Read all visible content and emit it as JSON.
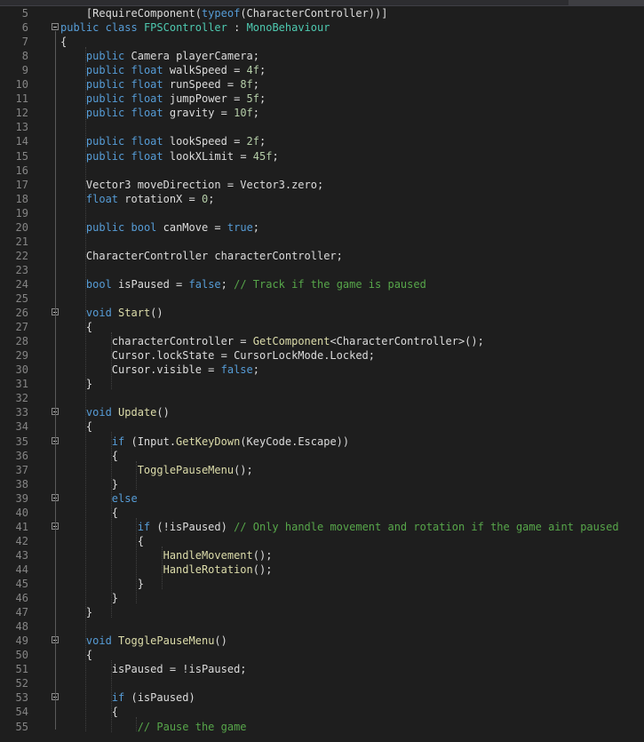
{
  "editor": {
    "lines": [
      {
        "n": "5",
        "t": [
          [
            "    ",
            "id"
          ],
          [
            "[RequireComponent(",
            "id"
          ],
          [
            "typeof",
            "kw"
          ],
          [
            "(CharacterController))]",
            "id"
          ]
        ]
      },
      {
        "n": "6",
        "fold": true,
        "t": [
          [
            "public",
            "kw"
          ],
          [
            " ",
            "id"
          ],
          [
            "class",
            "kw"
          ],
          [
            " ",
            "id"
          ],
          [
            "FPSController",
            "ty"
          ],
          [
            " : ",
            "id"
          ],
          [
            "MonoBehaviour",
            "ty"
          ]
        ]
      },
      {
        "n": "7",
        "t": [
          [
            "{",
            "id"
          ]
        ]
      },
      {
        "n": "8",
        "t": [
          [
            "    ",
            "id"
          ],
          [
            "public",
            "kw"
          ],
          [
            " Camera playerCamera;",
            "id"
          ]
        ]
      },
      {
        "n": "9",
        "t": [
          [
            "    ",
            "id"
          ],
          [
            "public",
            "kw"
          ],
          [
            " ",
            "id"
          ],
          [
            "float",
            "kw"
          ],
          [
            " walkSpeed = ",
            "id"
          ],
          [
            "4f",
            "nu"
          ],
          [
            ";",
            "id"
          ]
        ]
      },
      {
        "n": "10",
        "t": [
          [
            "    ",
            "id"
          ],
          [
            "public",
            "kw"
          ],
          [
            " ",
            "id"
          ],
          [
            "float",
            "kw"
          ],
          [
            " runSpeed = ",
            "id"
          ],
          [
            "8f",
            "nu"
          ],
          [
            ";",
            "id"
          ]
        ]
      },
      {
        "n": "11",
        "t": [
          [
            "    ",
            "id"
          ],
          [
            "public",
            "kw"
          ],
          [
            " ",
            "id"
          ],
          [
            "float",
            "kw"
          ],
          [
            " jumpPower = ",
            "id"
          ],
          [
            "5f",
            "nu"
          ],
          [
            ";",
            "id"
          ]
        ]
      },
      {
        "n": "12",
        "t": [
          [
            "    ",
            "id"
          ],
          [
            "public",
            "kw"
          ],
          [
            " ",
            "id"
          ],
          [
            "float",
            "kw"
          ],
          [
            " gravity = ",
            "id"
          ],
          [
            "10f",
            "nu"
          ],
          [
            ";",
            "id"
          ]
        ]
      },
      {
        "n": "13",
        "t": []
      },
      {
        "n": "14",
        "t": [
          [
            "    ",
            "id"
          ],
          [
            "public",
            "kw"
          ],
          [
            " ",
            "id"
          ],
          [
            "float",
            "kw"
          ],
          [
            " lookSpeed = ",
            "id"
          ],
          [
            "2f",
            "nu"
          ],
          [
            ";",
            "id"
          ]
        ]
      },
      {
        "n": "15",
        "t": [
          [
            "    ",
            "id"
          ],
          [
            "public",
            "kw"
          ],
          [
            " ",
            "id"
          ],
          [
            "float",
            "kw"
          ],
          [
            " lookXLimit = ",
            "id"
          ],
          [
            "45f",
            "nu"
          ],
          [
            ";",
            "id"
          ]
        ]
      },
      {
        "n": "16",
        "t": []
      },
      {
        "n": "17",
        "t": [
          [
            "    Vector3 moveDirection = Vector3.zero;",
            "id"
          ]
        ]
      },
      {
        "n": "18",
        "t": [
          [
            "    ",
            "id"
          ],
          [
            "float",
            "kw"
          ],
          [
            " rotationX = ",
            "id"
          ],
          [
            "0",
            "nu"
          ],
          [
            ";",
            "id"
          ]
        ]
      },
      {
        "n": "19",
        "t": []
      },
      {
        "n": "20",
        "t": [
          [
            "    ",
            "id"
          ],
          [
            "public",
            "kw"
          ],
          [
            " ",
            "id"
          ],
          [
            "bool",
            "kw"
          ],
          [
            " canMove = ",
            "id"
          ],
          [
            "true",
            "kw"
          ],
          [
            ";",
            "id"
          ]
        ]
      },
      {
        "n": "21",
        "t": []
      },
      {
        "n": "22",
        "t": [
          [
            "    CharacterController characterController;",
            "id"
          ]
        ]
      },
      {
        "n": "23",
        "t": []
      },
      {
        "n": "24",
        "t": [
          [
            "    ",
            "id"
          ],
          [
            "bool",
            "kw"
          ],
          [
            " isPaused = ",
            "id"
          ],
          [
            "false",
            "kw"
          ],
          [
            "; ",
            "id"
          ],
          [
            "// Track if the game is paused",
            "cm"
          ]
        ]
      },
      {
        "n": "25",
        "t": []
      },
      {
        "n": "26",
        "fold": true,
        "t": [
          [
            "    ",
            "id"
          ],
          [
            "void",
            "kw"
          ],
          [
            " ",
            "id"
          ],
          [
            "Start",
            "fn"
          ],
          [
            "()",
            "id"
          ]
        ]
      },
      {
        "n": "27",
        "t": [
          [
            "    {",
            "id"
          ]
        ]
      },
      {
        "n": "28",
        "t": [
          [
            "        characterController = ",
            "id"
          ],
          [
            "GetComponent",
            "fn"
          ],
          [
            "<CharacterController>();",
            "id"
          ]
        ]
      },
      {
        "n": "29",
        "t": [
          [
            "        Cursor.lockState = CursorLockMode.Locked;",
            "id"
          ]
        ]
      },
      {
        "n": "30",
        "t": [
          [
            "        Cursor.visible = ",
            "id"
          ],
          [
            "false",
            "kw"
          ],
          [
            ";",
            "id"
          ]
        ]
      },
      {
        "n": "31",
        "t": [
          [
            "    }",
            "id"
          ]
        ]
      },
      {
        "n": "32",
        "t": []
      },
      {
        "n": "33",
        "fold": true,
        "t": [
          [
            "    ",
            "id"
          ],
          [
            "void",
            "kw"
          ],
          [
            " ",
            "id"
          ],
          [
            "Update",
            "fn"
          ],
          [
            "()",
            "id"
          ]
        ]
      },
      {
        "n": "34",
        "t": [
          [
            "    {",
            "id"
          ]
        ]
      },
      {
        "n": "35",
        "fold": true,
        "t": [
          [
            "        ",
            "id"
          ],
          [
            "if",
            "kw"
          ],
          [
            " (Input.",
            "id"
          ],
          [
            "GetKeyDown",
            "fn"
          ],
          [
            "(KeyCode.Escape))",
            "id"
          ]
        ]
      },
      {
        "n": "36",
        "t": [
          [
            "        {",
            "id"
          ]
        ]
      },
      {
        "n": "37",
        "t": [
          [
            "            ",
            "id"
          ],
          [
            "TogglePauseMenu",
            "fn"
          ],
          [
            "();",
            "id"
          ]
        ]
      },
      {
        "n": "38",
        "t": [
          [
            "        }",
            "id"
          ]
        ]
      },
      {
        "n": "39",
        "fold": true,
        "t": [
          [
            "        ",
            "id"
          ],
          [
            "else",
            "kw"
          ]
        ]
      },
      {
        "n": "40",
        "t": [
          [
            "        {",
            "id"
          ]
        ]
      },
      {
        "n": "41",
        "fold": true,
        "t": [
          [
            "            ",
            "id"
          ],
          [
            "if",
            "kw"
          ],
          [
            " (!isPaused) ",
            "id"
          ],
          [
            "// Only handle movement and rotation if the game aint paused",
            "cm"
          ]
        ]
      },
      {
        "n": "42",
        "t": [
          [
            "            {",
            "id"
          ]
        ]
      },
      {
        "n": "43",
        "t": [
          [
            "                ",
            "id"
          ],
          [
            "HandleMovement",
            "fn"
          ],
          [
            "();",
            "id"
          ]
        ]
      },
      {
        "n": "44",
        "t": [
          [
            "                ",
            "id"
          ],
          [
            "HandleRotation",
            "fn"
          ],
          [
            "();",
            "id"
          ]
        ]
      },
      {
        "n": "45",
        "t": [
          [
            "            }",
            "id"
          ]
        ]
      },
      {
        "n": "46",
        "t": [
          [
            "        }",
            "id"
          ]
        ]
      },
      {
        "n": "47",
        "t": [
          [
            "    }",
            "id"
          ]
        ]
      },
      {
        "n": "48",
        "t": []
      },
      {
        "n": "49",
        "fold": true,
        "t": [
          [
            "    ",
            "id"
          ],
          [
            "void",
            "kw"
          ],
          [
            " ",
            "id"
          ],
          [
            "TogglePauseMenu",
            "fn"
          ],
          [
            "()",
            "id"
          ]
        ]
      },
      {
        "n": "50",
        "t": [
          [
            "    {",
            "id"
          ]
        ]
      },
      {
        "n": "51",
        "t": [
          [
            "        isPaused = !isPaused;",
            "id"
          ]
        ]
      },
      {
        "n": "52",
        "t": []
      },
      {
        "n": "53",
        "fold": true,
        "t": [
          [
            "        ",
            "id"
          ],
          [
            "if",
            "kw"
          ],
          [
            " (isPaused)",
            "id"
          ]
        ]
      },
      {
        "n": "54",
        "t": [
          [
            "        {",
            "id"
          ]
        ]
      },
      {
        "n": "55",
        "t": [
          [
            "            ",
            "id"
          ],
          [
            "// Pause the game",
            "cm"
          ]
        ]
      }
    ]
  }
}
